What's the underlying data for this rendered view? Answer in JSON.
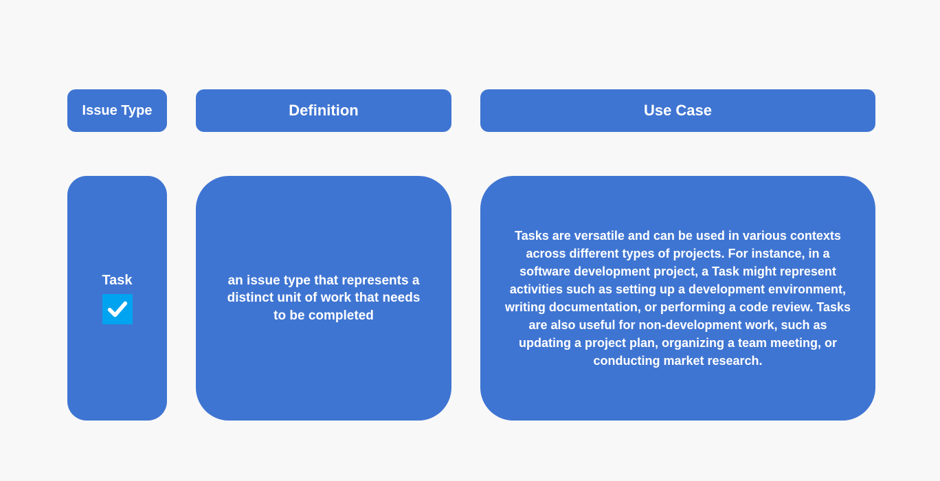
{
  "headers": {
    "issue_type": "Issue Type",
    "definition": "Definition",
    "use_case": "Use Case"
  },
  "row": {
    "name": "Task",
    "icon": "checkmark-icon",
    "definition": "an issue type that represents a distinct unit of work that needs to be completed",
    "use_case": "Tasks are versatile and can be used in various contexts across different types of projects. For instance, in a software development project, a Task might represent activities such as setting up a development environment, writing documentation, or performing a code review. Tasks are also useful for non-development work, such as updating a project plan, organizing a team meeting, or conducting market research."
  },
  "colors": {
    "primary": "#3f75d2",
    "icon_bg": "#00a3ef"
  }
}
